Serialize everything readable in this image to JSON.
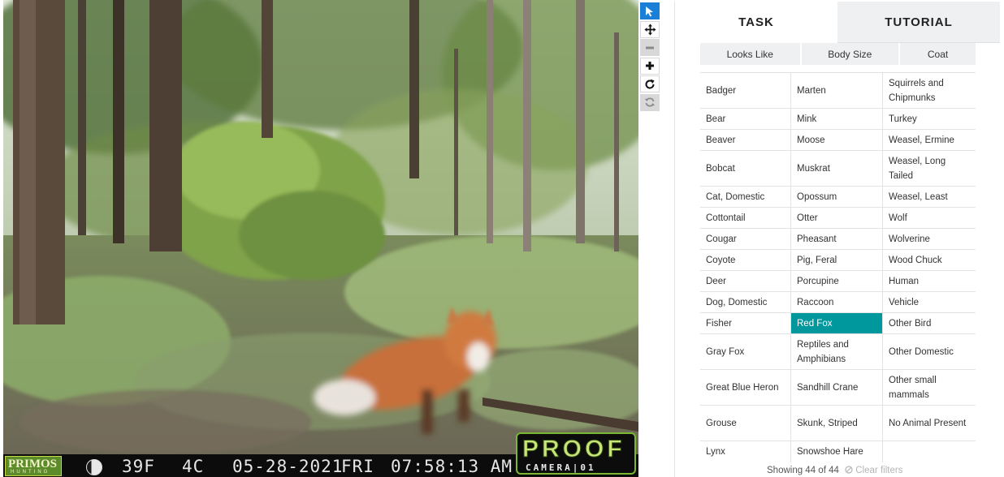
{
  "camera": {
    "brand": "PRIMOS",
    "brand_sub": "HUNTING",
    "temp_f": "39F",
    "temp_c": "4C",
    "date": "05-28-2021",
    "day": "FRI",
    "time": "07:58:13 AM",
    "proof_word": "PROOF",
    "proof_sub": "CAMERA|01"
  },
  "toolbar": {
    "tools": [
      {
        "name": "pointer-tool",
        "icon": "cursor-icon",
        "active": true
      },
      {
        "name": "pan-tool",
        "icon": "move-icon",
        "active": false
      },
      {
        "name": "zoom-out-tool",
        "icon": "minus-icon",
        "disabled": true
      },
      {
        "name": "zoom-in-tool",
        "icon": "plus-icon",
        "active": false
      },
      {
        "name": "rotate-tool",
        "icon": "rotate-icon",
        "active": false
      },
      {
        "name": "reset-tool",
        "icon": "refresh-icon",
        "disabled": true
      }
    ]
  },
  "tabs": [
    {
      "label": "TASK",
      "active": true
    },
    {
      "label": "TUTORIAL",
      "active": false
    }
  ],
  "filters": [
    "Looks Like",
    "Body Size",
    "Coat"
  ],
  "species": [
    [
      "Badger",
      "Marten",
      "Squirrels and Chipmunks"
    ],
    [
      "Bear",
      "Mink",
      "Turkey"
    ],
    [
      "Beaver",
      "Moose",
      "Weasel, Ermine"
    ],
    [
      "Bobcat",
      "Muskrat",
      "Weasel, Long Tailed"
    ],
    [
      "Cat, Domestic",
      "Opossum",
      "Weasel, Least"
    ],
    [
      "Cottontail",
      "Otter",
      "Wolf"
    ],
    [
      "Cougar",
      "Pheasant",
      "Wolverine"
    ],
    [
      "Coyote",
      "Pig, Feral",
      "Wood Chuck"
    ],
    [
      "Deer",
      "Porcupine",
      "Human"
    ],
    [
      "Dog, Domestic",
      "Raccoon",
      "Vehicle"
    ],
    [
      "Fisher",
      "Red Fox",
      "Other Bird"
    ],
    [
      "Gray Fox",
      "Reptiles and Amphibians",
      "Other Domestic"
    ],
    [
      "Great Blue Heron",
      "Sandhill Crane",
      "Other small mammals"
    ],
    [
      "Grouse",
      "Skunk, Striped",
      "No Animal Present"
    ],
    [
      "Lynx",
      "Snowshoe Hare",
      ""
    ]
  ],
  "selected_species": "Red Fox",
  "footer": {
    "showing": "Showing 44 of 44",
    "clear": "Clear filters"
  },
  "colors": {
    "selected": "#00979d",
    "tool_active": "#1b7fd8"
  }
}
